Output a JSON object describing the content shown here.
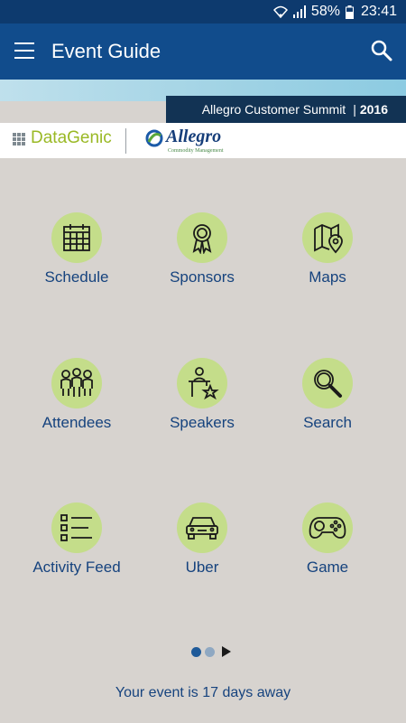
{
  "status_bar": {
    "battery": "58%",
    "time": "23:41"
  },
  "app_bar": {
    "title": "Event Guide",
    "menu_icon": "hamburger-menu-icon",
    "search_icon": "search-icon"
  },
  "banner": {
    "event_name": "Allegro Customer Summit",
    "separator": "|",
    "year": "2016"
  },
  "logos": {
    "datagenic": "DataGenic",
    "allegro": "Allegro",
    "allegro_tagline": "Commodity Management"
  },
  "grid": [
    {
      "label": "Schedule",
      "icon": "calendar-icon"
    },
    {
      "label": "Sponsors",
      "icon": "award-ribbon-icon"
    },
    {
      "label": "Maps",
      "icon": "map-pin-icon"
    },
    {
      "label": "Attendees",
      "icon": "people-icon"
    },
    {
      "label": "Speakers",
      "icon": "speaker-podium-icon"
    },
    {
      "label": "Search",
      "icon": "magnifier-icon"
    },
    {
      "label": "Activity Feed",
      "icon": "list-icon"
    },
    {
      "label": "Uber",
      "icon": "car-icon"
    },
    {
      "label": "Game",
      "icon": "gamepad-icon"
    }
  ],
  "pager": {
    "pages": 2,
    "active": 1
  },
  "footer": {
    "countdown": "Your event is 17 days away"
  },
  "colors": {
    "app_bar": "#114c8c",
    "status_bar": "#0d3a6e",
    "background": "#d7d3cf",
    "icon_circle": "#c4dd8a",
    "label": "#16437e"
  }
}
